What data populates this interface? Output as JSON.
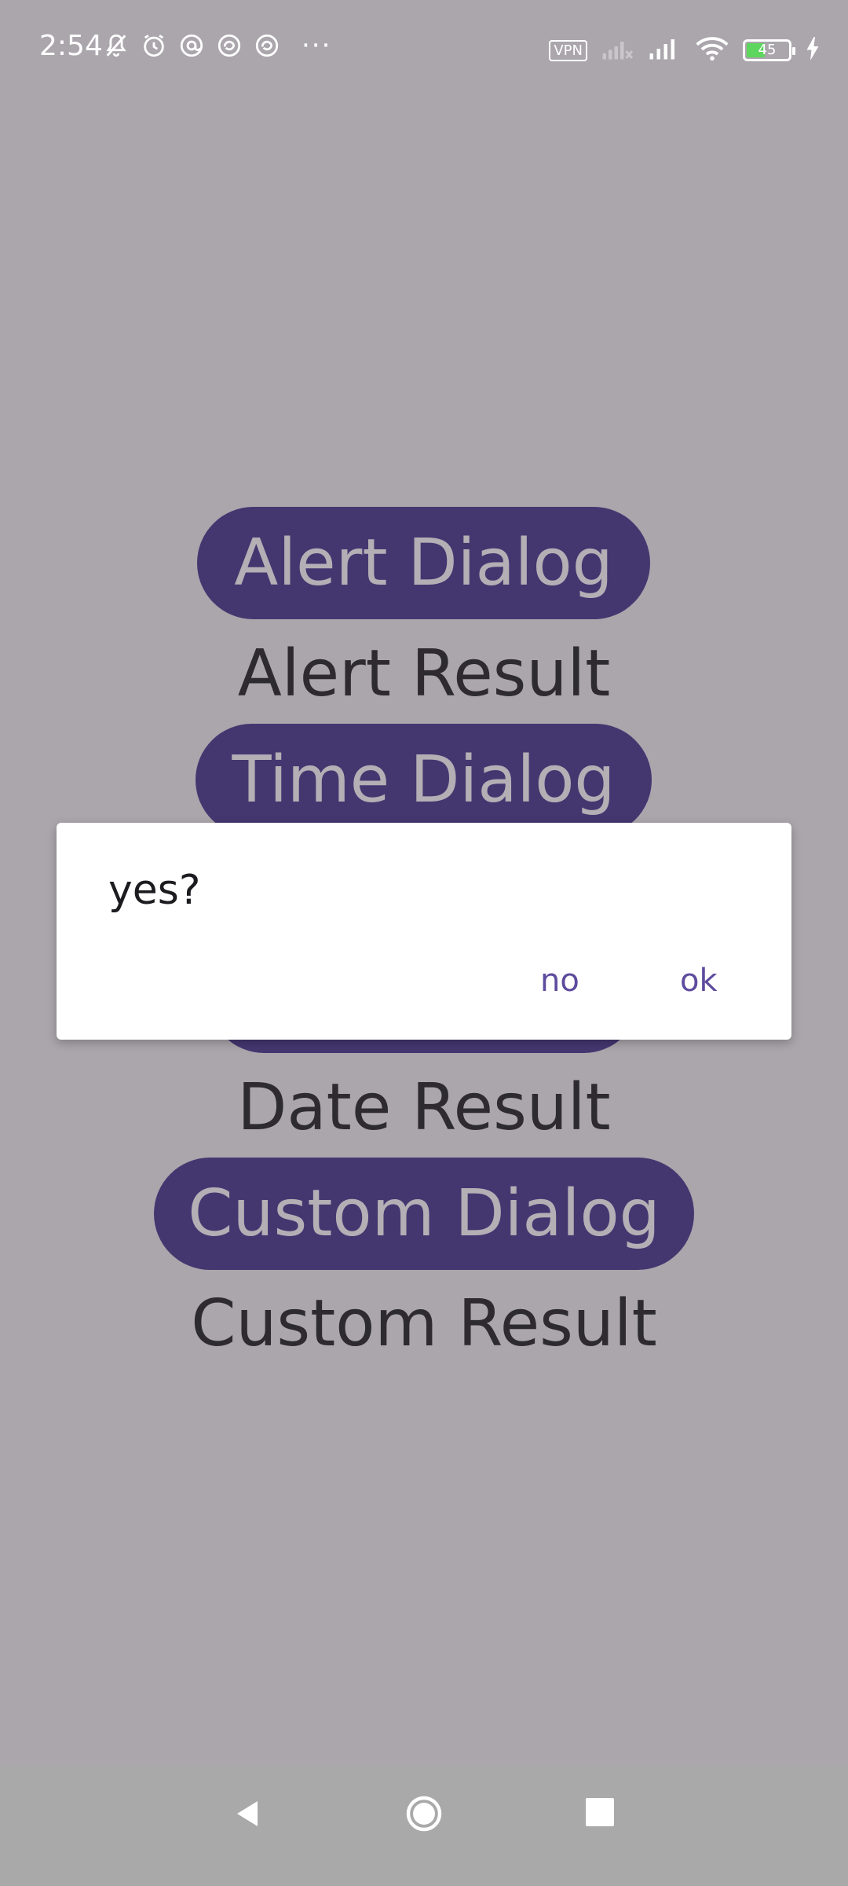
{
  "status_bar": {
    "time": "2:54",
    "vpn_label": "VPN",
    "battery_level": "45",
    "battery_fraction": 0.45,
    "icons_left": [
      "mute-bell-icon",
      "alarm-icon",
      "at-icon",
      "sync-icon",
      "sync-icon",
      "more-dots-icon"
    ],
    "icons_right": [
      "vpn-icon",
      "signal-weak-icon",
      "signal-icon",
      "wifi-icon",
      "battery-icon",
      "charging-icon"
    ],
    "more": "···"
  },
  "main": {
    "alert_button": "Alert Dialog",
    "alert_result": "Alert Result",
    "time_button": "Time Dialog",
    "date_result": "Date Result",
    "custom_button": "Custom Dialog",
    "custom_result": "Custom Result"
  },
  "dialog": {
    "message": "yes?",
    "negative": "no",
    "positive": "ok"
  },
  "nav": {
    "icons": [
      "back-icon",
      "home-icon",
      "recents-icon"
    ]
  },
  "colors": {
    "scrim_background": "#aaa6ac",
    "button_fill": "#443770",
    "button_text": "#b3afb5",
    "dialog_accent": "#5e4b9d"
  }
}
